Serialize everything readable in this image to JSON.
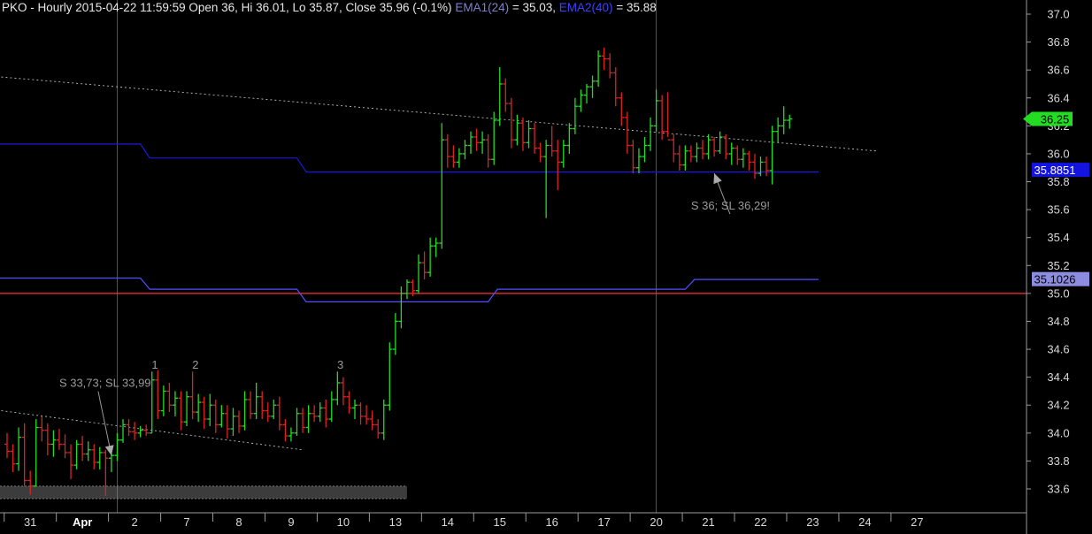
{
  "title": {
    "symbol_info": "PKO - Hourly 2015-04-22 11:59:59 Open 36, Hi 36.01, Lo 35.87, Close 35.96 (-0.1%)",
    "ema1_label": "EMA1(24)",
    "ema1_value": " = 35.03, ",
    "ema2_label": "EMA2(40)",
    "ema2_value": " = 35.88"
  },
  "colors": {
    "background": "#000000",
    "up_bar": "#22dd22",
    "down_bar": "#dd2222",
    "ema1": "#5050ff",
    "ema2": "#2020d0",
    "level_line": "#ff3030",
    "trendline": "#bbbbbb",
    "current_price_tag": "#22dd22",
    "annotation": "#9a9a9a"
  },
  "chart_data": {
    "type": "ohlc",
    "y_axis": {
      "range": [
        33.45,
        37.07
      ],
      "ticks": [
        "37.0",
        "36.8",
        "36.6",
        "36.4",
        "36.2",
        "36.0",
        "35.8",
        "35.6",
        "35.4",
        "35.2",
        "35.0",
        "34.8",
        "34.6",
        "34.4",
        "34.2",
        "34.0",
        "33.8",
        "33.6"
      ]
    },
    "x_axis": {
      "sessions": [
        "31",
        "Apr",
        "2",
        "7",
        "8",
        "9",
        "10",
        "13",
        "14",
        "15",
        "16",
        "17",
        "20",
        "21",
        "22",
        "23",
        "24",
        "27"
      ],
      "bars_per_session": 9
    },
    "price_tags": [
      {
        "label": "36.25",
        "value": 36.25,
        "color": "#22dd22",
        "text_color": "#000000"
      },
      {
        "label": "35.8851",
        "value": 35.8851,
        "color": "#1414e0",
        "text_color": "#ffffff"
      },
      {
        "label": "35.1026",
        "value": 35.1026,
        "color": "#8c8ce0",
        "text_color": "#000000"
      }
    ],
    "level_line": 35.0,
    "ema_steps": [
      {
        "name": "EMA2(40)",
        "color": "#1a1ad8",
        "segments": [
          {
            "from": 0,
            "to": 23,
            "value": 36.07
          },
          {
            "from": 24,
            "to": 50,
            "value": 35.97
          },
          {
            "from": 51,
            "to": 140,
            "value": 35.87
          }
        ]
      },
      {
        "name": "EMA1(24)",
        "color": "#5050ff",
        "segments": [
          {
            "from": 0,
            "to": 23,
            "value": 35.11
          },
          {
            "from": 24,
            "to": 50,
            "value": 35.03
          },
          {
            "from": 51,
            "to": 83,
            "value": 34.94
          },
          {
            "from": 84,
            "to": 117,
            "value": 35.03
          },
          {
            "from": 118,
            "to": 140,
            "value": 35.1
          }
        ]
      }
    ],
    "trendlines": [
      {
        "from": [
          -1,
          36.55
        ],
        "to": [
          150,
          36.02
        ]
      },
      {
        "from": [
          -1,
          34.16
        ],
        "to": [
          51,
          33.88
        ]
      }
    ],
    "support_band": [
      33.53,
      33.62
    ],
    "annotations": [
      {
        "text": "S 33,73; SL 33,99",
        "bar": 9,
        "price": 34.33,
        "target_bar": 18,
        "target_price": 33.84
      },
      {
        "text": "S 36; SL 36,29!",
        "bar": 118,
        "price": 35.6,
        "target_bar": 122,
        "target_price": 35.86
      },
      {
        "text": "1",
        "bar": 25.5,
        "price": 34.46
      },
      {
        "text": "2",
        "bar": 32.5,
        "price": 34.46
      },
      {
        "text": "3",
        "bar": 57.5,
        "price": 34.46
      }
    ],
    "bars": [
      {
        "o": 33.92,
        "h": 34.0,
        "l": 33.82,
        "c": 33.87
      },
      {
        "o": 33.87,
        "h": 33.92,
        "l": 33.72,
        "c": 33.78
      },
      {
        "o": 33.78,
        "h": 34.04,
        "l": 33.73,
        "c": 33.97
      },
      {
        "o": 33.97,
        "h": 34.07,
        "l": 33.62,
        "c": 33.66
      },
      {
        "o": 33.66,
        "h": 33.73,
        "l": 33.56,
        "c": 33.62
      },
      {
        "o": 33.62,
        "h": 34.1,
        "l": 33.62,
        "c": 34.04
      },
      {
        "o": 34.04,
        "h": 34.12,
        "l": 33.94,
        "c": 34.02
      },
      {
        "o": 34.02,
        "h": 34.07,
        "l": 33.84,
        "c": 33.92
      },
      {
        "o": 33.92,
        "h": 34.02,
        "l": 33.83,
        "c": 33.95
      },
      {
        "o": 33.95,
        "h": 34.03,
        "l": 33.88,
        "c": 33.92
      },
      {
        "o": 33.92,
        "h": 33.99,
        "l": 33.82,
        "c": 33.86
      },
      {
        "o": 33.86,
        "h": 33.92,
        "l": 33.67,
        "c": 33.77
      },
      {
        "o": 33.77,
        "h": 33.95,
        "l": 33.74,
        "c": 33.92
      },
      {
        "o": 33.92,
        "h": 33.98,
        "l": 33.8,
        "c": 33.85
      },
      {
        "o": 33.85,
        "h": 33.94,
        "l": 33.8,
        "c": 33.88
      },
      {
        "o": 33.88,
        "h": 33.92,
        "l": 33.74,
        "c": 33.79
      },
      {
        "o": 33.79,
        "h": 33.9,
        "l": 33.74,
        "c": 33.86
      },
      {
        "o": 33.86,
        "h": 33.88,
        "l": 33.55,
        "c": 33.82
      },
      {
        "o": 33.82,
        "h": 33.9,
        "l": 33.72,
        "c": 33.84
      },
      {
        "o": 33.84,
        "h": 34.0,
        "l": 33.8,
        "c": 33.95
      },
      {
        "o": 33.95,
        "h": 34.1,
        "l": 33.93,
        "c": 34.06
      },
      {
        "o": 34.06,
        "h": 34.1,
        "l": 33.98,
        "c": 34.01
      },
      {
        "o": 34.01,
        "h": 34.08,
        "l": 33.95,
        "c": 34.0
      },
      {
        "o": 34.0,
        "h": 34.05,
        "l": 33.97,
        "c": 34.02
      },
      {
        "o": 34.02,
        "h": 34.06,
        "l": 33.98,
        "c": 34.0
      },
      {
        "o": 34.0,
        "h": 34.44,
        "l": 34.0,
        "c": 34.38
      },
      {
        "o": 34.38,
        "h": 34.45,
        "l": 34.1,
        "c": 34.16
      },
      {
        "o": 34.16,
        "h": 34.34,
        "l": 34.12,
        "c": 34.3
      },
      {
        "o": 34.3,
        "h": 34.36,
        "l": 34.15,
        "c": 34.2
      },
      {
        "o": 34.2,
        "h": 34.3,
        "l": 34.12,
        "c": 34.25
      },
      {
        "o": 34.25,
        "h": 34.3,
        "l": 34.02,
        "c": 34.08
      },
      {
        "o": 34.08,
        "h": 34.3,
        "l": 34.05,
        "c": 34.26
      },
      {
        "o": 34.26,
        "h": 34.44,
        "l": 34.1,
        "c": 34.15
      },
      {
        "o": 34.15,
        "h": 34.28,
        "l": 34.08,
        "c": 34.22
      },
      {
        "o": 34.22,
        "h": 34.26,
        "l": 34.03,
        "c": 34.1
      },
      {
        "o": 34.1,
        "h": 34.28,
        "l": 34.05,
        "c": 34.2
      },
      {
        "o": 34.2,
        "h": 34.24,
        "l": 34.0,
        "c": 34.06
      },
      {
        "o": 34.06,
        "h": 34.2,
        "l": 34.04,
        "c": 34.14
      },
      {
        "o": 34.14,
        "h": 34.2,
        "l": 33.96,
        "c": 34.03
      },
      {
        "o": 34.03,
        "h": 34.18,
        "l": 33.98,
        "c": 34.12
      },
      {
        "o": 34.12,
        "h": 34.16,
        "l": 34.0,
        "c": 34.05
      },
      {
        "o": 34.05,
        "h": 34.3,
        "l": 34.02,
        "c": 34.24
      },
      {
        "o": 34.24,
        "h": 34.3,
        "l": 34.1,
        "c": 34.14
      },
      {
        "o": 34.14,
        "h": 34.36,
        "l": 34.1,
        "c": 34.26
      },
      {
        "o": 34.26,
        "h": 34.3,
        "l": 34.1,
        "c": 34.16
      },
      {
        "o": 34.16,
        "h": 34.22,
        "l": 34.08,
        "c": 34.12
      },
      {
        "o": 34.12,
        "h": 34.24,
        "l": 34.1,
        "c": 34.2
      },
      {
        "o": 34.2,
        "h": 34.26,
        "l": 34.02,
        "c": 34.06
      },
      {
        "o": 34.06,
        "h": 34.1,
        "l": 33.94,
        "c": 33.98
      },
      {
        "o": 33.98,
        "h": 34.04,
        "l": 33.94,
        "c": 34.0
      },
      {
        "o": 34.0,
        "h": 34.18,
        "l": 33.98,
        "c": 34.14
      },
      {
        "o": 34.14,
        "h": 34.18,
        "l": 34.0,
        "c": 34.04
      },
      {
        "o": 34.04,
        "h": 34.2,
        "l": 34.0,
        "c": 34.14
      },
      {
        "o": 34.14,
        "h": 34.2,
        "l": 34.08,
        "c": 34.12
      },
      {
        "o": 34.12,
        "h": 34.22,
        "l": 34.08,
        "c": 34.18
      },
      {
        "o": 34.18,
        "h": 34.24,
        "l": 34.04,
        "c": 34.1
      },
      {
        "o": 34.1,
        "h": 34.3,
        "l": 34.08,
        "c": 34.24
      },
      {
        "o": 34.24,
        "h": 34.44,
        "l": 34.2,
        "c": 34.36
      },
      {
        "o": 34.36,
        "h": 34.4,
        "l": 34.2,
        "c": 34.26
      },
      {
        "o": 34.26,
        "h": 34.3,
        "l": 34.14,
        "c": 34.18
      },
      {
        "o": 34.18,
        "h": 34.24,
        "l": 34.1,
        "c": 34.2
      },
      {
        "o": 34.2,
        "h": 34.22,
        "l": 34.06,
        "c": 34.12
      },
      {
        "o": 34.12,
        "h": 34.2,
        "l": 34.06,
        "c": 34.1
      },
      {
        "o": 34.1,
        "h": 34.16,
        "l": 34.02,
        "c": 34.06
      },
      {
        "o": 34.06,
        "h": 34.1,
        "l": 33.96,
        "c": 34.0
      },
      {
        "o": 34.0,
        "h": 34.24,
        "l": 33.95,
        "c": 34.2
      },
      {
        "o": 34.2,
        "h": 34.65,
        "l": 34.16,
        "c": 34.6
      },
      {
        "o": 34.6,
        "h": 34.86,
        "l": 34.56,
        "c": 34.8
      },
      {
        "o": 34.8,
        "h": 35.05,
        "l": 34.75,
        "c": 35.0
      },
      {
        "o": 35.0,
        "h": 35.1,
        "l": 34.96,
        "c": 35.08
      },
      {
        "o": 35.08,
        "h": 35.1,
        "l": 34.98,
        "c": 35.02
      },
      {
        "o": 35.02,
        "h": 35.28,
        "l": 35.0,
        "c": 35.22
      },
      {
        "o": 35.22,
        "h": 35.3,
        "l": 35.1,
        "c": 35.15
      },
      {
        "o": 35.15,
        "h": 35.4,
        "l": 35.12,
        "c": 35.34
      },
      {
        "o": 35.34,
        "h": 35.4,
        "l": 35.26,
        "c": 35.36
      },
      {
        "o": 35.36,
        "h": 36.22,
        "l": 35.32,
        "c": 36.1
      },
      {
        "o": 36.1,
        "h": 36.14,
        "l": 35.9,
        "c": 35.98
      },
      {
        "o": 35.98,
        "h": 36.06,
        "l": 35.9,
        "c": 35.94
      },
      {
        "o": 35.94,
        "h": 36.04,
        "l": 35.9,
        "c": 36.0
      },
      {
        "o": 36.0,
        "h": 36.1,
        "l": 35.96,
        "c": 36.06
      },
      {
        "o": 36.06,
        "h": 36.16,
        "l": 36.0,
        "c": 36.12
      },
      {
        "o": 36.12,
        "h": 36.18,
        "l": 36.02,
        "c": 36.08
      },
      {
        "o": 36.08,
        "h": 36.16,
        "l": 36.0,
        "c": 36.1
      },
      {
        "o": 36.1,
        "h": 36.14,
        "l": 35.9,
        "c": 35.96
      },
      {
        "o": 35.96,
        "h": 36.3,
        "l": 35.92,
        "c": 36.24
      },
      {
        "o": 36.24,
        "h": 36.62,
        "l": 36.2,
        "c": 36.5
      },
      {
        "o": 36.5,
        "h": 36.54,
        "l": 36.3,
        "c": 36.36
      },
      {
        "o": 36.36,
        "h": 36.4,
        "l": 36.04,
        "c": 36.1
      },
      {
        "o": 36.1,
        "h": 36.28,
        "l": 36.06,
        "c": 36.22
      },
      {
        "o": 36.22,
        "h": 36.26,
        "l": 36.02,
        "c": 36.08
      },
      {
        "o": 36.08,
        "h": 36.24,
        "l": 36.04,
        "c": 36.18
      },
      {
        "o": 36.18,
        "h": 36.22,
        "l": 36.0,
        "c": 36.04
      },
      {
        "o": 36.04,
        "h": 36.08,
        "l": 35.94,
        "c": 35.98
      },
      {
        "o": 35.98,
        "h": 36.1,
        "l": 35.54,
        "c": 36.06
      },
      {
        "o": 36.06,
        "h": 36.2,
        "l": 35.98,
        "c": 36.02
      },
      {
        "o": 36.02,
        "h": 36.1,
        "l": 35.74,
        "c": 35.94
      },
      {
        "o": 35.94,
        "h": 36.1,
        "l": 35.9,
        "c": 36.06
      },
      {
        "o": 36.06,
        "h": 36.22,
        "l": 36.0,
        "c": 36.18
      },
      {
        "o": 36.18,
        "h": 36.4,
        "l": 36.14,
        "c": 36.34
      },
      {
        "o": 36.34,
        "h": 36.46,
        "l": 36.3,
        "c": 36.42
      },
      {
        "o": 36.42,
        "h": 36.5,
        "l": 36.36,
        "c": 36.48
      },
      {
        "o": 36.48,
        "h": 36.56,
        "l": 36.4,
        "c": 36.52
      },
      {
        "o": 36.52,
        "h": 36.74,
        "l": 36.48,
        "c": 36.7
      },
      {
        "o": 36.7,
        "h": 36.76,
        "l": 36.6,
        "c": 36.68
      },
      {
        "o": 36.68,
        "h": 36.72,
        "l": 36.54,
        "c": 36.58
      },
      {
        "o": 36.58,
        "h": 36.62,
        "l": 36.34,
        "c": 36.4
      },
      {
        "o": 36.4,
        "h": 36.44,
        "l": 36.2,
        "c": 36.26
      },
      {
        "o": 36.26,
        "h": 36.3,
        "l": 36.0,
        "c": 36.06
      },
      {
        "o": 36.06,
        "h": 36.1,
        "l": 35.86,
        "c": 35.9
      },
      {
        "o": 35.9,
        "h": 36.04,
        "l": 35.86,
        "c": 35.98
      },
      {
        "o": 35.98,
        "h": 36.12,
        "l": 35.94,
        "c": 36.06
      },
      {
        "o": 36.06,
        "h": 36.26,
        "l": 36.02,
        "c": 36.2
      },
      {
        "o": 36.2,
        "h": 36.46,
        "l": 36.16,
        "c": 36.38
      },
      {
        "o": 36.38,
        "h": 36.42,
        "l": 36.1,
        "c": 36.16
      },
      {
        "o": 36.16,
        "h": 36.44,
        "l": 36.12,
        "c": 36.1
      },
      {
        "o": 36.1,
        "h": 36.14,
        "l": 35.94,
        "c": 36.0
      },
      {
        "o": 36.0,
        "h": 36.06,
        "l": 35.88,
        "c": 35.92
      },
      {
        "o": 35.92,
        "h": 36.06,
        "l": 35.88,
        "c": 36.02
      },
      {
        "o": 36.02,
        "h": 36.06,
        "l": 35.94,
        "c": 35.98
      },
      {
        "o": 35.98,
        "h": 36.08,
        "l": 35.94,
        "c": 36.04
      },
      {
        "o": 36.04,
        "h": 36.1,
        "l": 35.96,
        "c": 36.0
      },
      {
        "o": 36.0,
        "h": 36.14,
        "l": 35.96,
        "c": 36.1
      },
      {
        "o": 36.1,
        "h": 36.12,
        "l": 35.98,
        "c": 36.02
      },
      {
        "o": 36.02,
        "h": 36.16,
        "l": 36.0,
        "c": 36.12
      },
      {
        "o": 36.12,
        "h": 36.14,
        "l": 35.96,
        "c": 36.0
      },
      {
        "o": 36.0,
        "h": 36.08,
        "l": 35.92,
        "c": 36.04
      },
      {
        "o": 36.04,
        "h": 36.06,
        "l": 35.92,
        "c": 35.96
      },
      {
        "o": 35.96,
        "h": 36.04,
        "l": 35.9,
        "c": 36.0
      },
      {
        "o": 36.0,
        "h": 36.02,
        "l": 35.88,
        "c": 35.94
      },
      {
        "o": 35.94,
        "h": 36.0,
        "l": 35.82,
        "c": 35.86
      },
      {
        "o": 35.86,
        "h": 35.98,
        "l": 35.84,
        "c": 35.94
      },
      {
        "o": 35.94,
        "h": 35.98,
        "l": 35.84,
        "c": 35.88
      },
      {
        "o": 35.88,
        "h": 36.2,
        "l": 35.78,
        "c": 36.16
      },
      {
        "o": 36.16,
        "h": 36.26,
        "l": 36.08,
        "c": 36.2
      },
      {
        "o": 36.2,
        "h": 36.34,
        "l": 36.14,
        "c": 36.24
      },
      {
        "o": 36.24,
        "h": 36.28,
        "l": 36.18,
        "c": 36.25
      }
    ]
  }
}
